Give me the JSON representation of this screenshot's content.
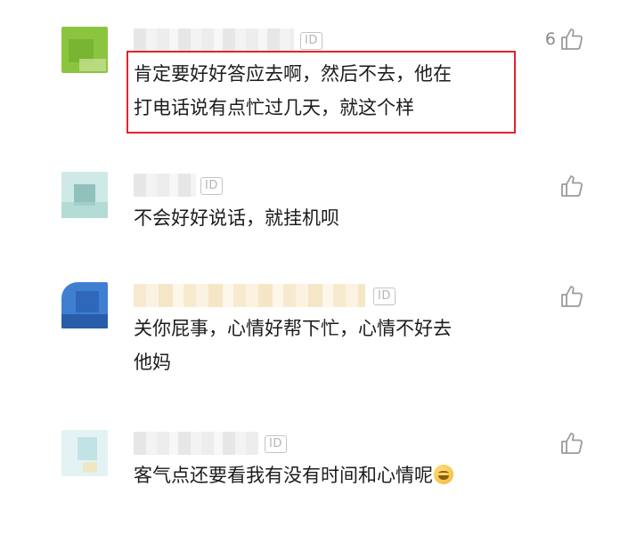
{
  "comments": [
    {
      "id_label": "ID",
      "likes": "6",
      "lines": [
        "肯定要好好答应去啊，然后不去，他在",
        "打电话说有点忙过几天，就这个样"
      ],
      "avatar_colors": [
        "#8bc53f",
        "#6fae2e"
      ],
      "highlighted": true
    },
    {
      "id_label": "ID",
      "likes": "",
      "lines": [
        "不会好好说话，就挂机呗"
      ],
      "avatar_colors": [
        "#a9d4cf",
        "#7fb7b2"
      ],
      "highlighted": false
    },
    {
      "id_label": "ID",
      "likes": "",
      "lines": [
        "关你屁事，心情好帮下忙，心情不好去",
        "他妈"
      ],
      "avatar_colors": [
        "#3f7fd1",
        "#2c63b5"
      ],
      "highlighted": false
    },
    {
      "id_label": "ID",
      "likes": "",
      "lines": [
        "客气点还要看我有没有时间和心情呢"
      ],
      "avatar_colors": [
        "#d7eef0",
        "#b9dfe2"
      ],
      "highlighted": false,
      "trailing_emoji": "grinning-face-emoji"
    }
  ],
  "colors": {
    "highlight_border": "#e0232b",
    "like_icon": "#9b9b9b",
    "text": "#1c1c1c"
  },
  "icons": {
    "like": "thumbs-up-icon"
  }
}
